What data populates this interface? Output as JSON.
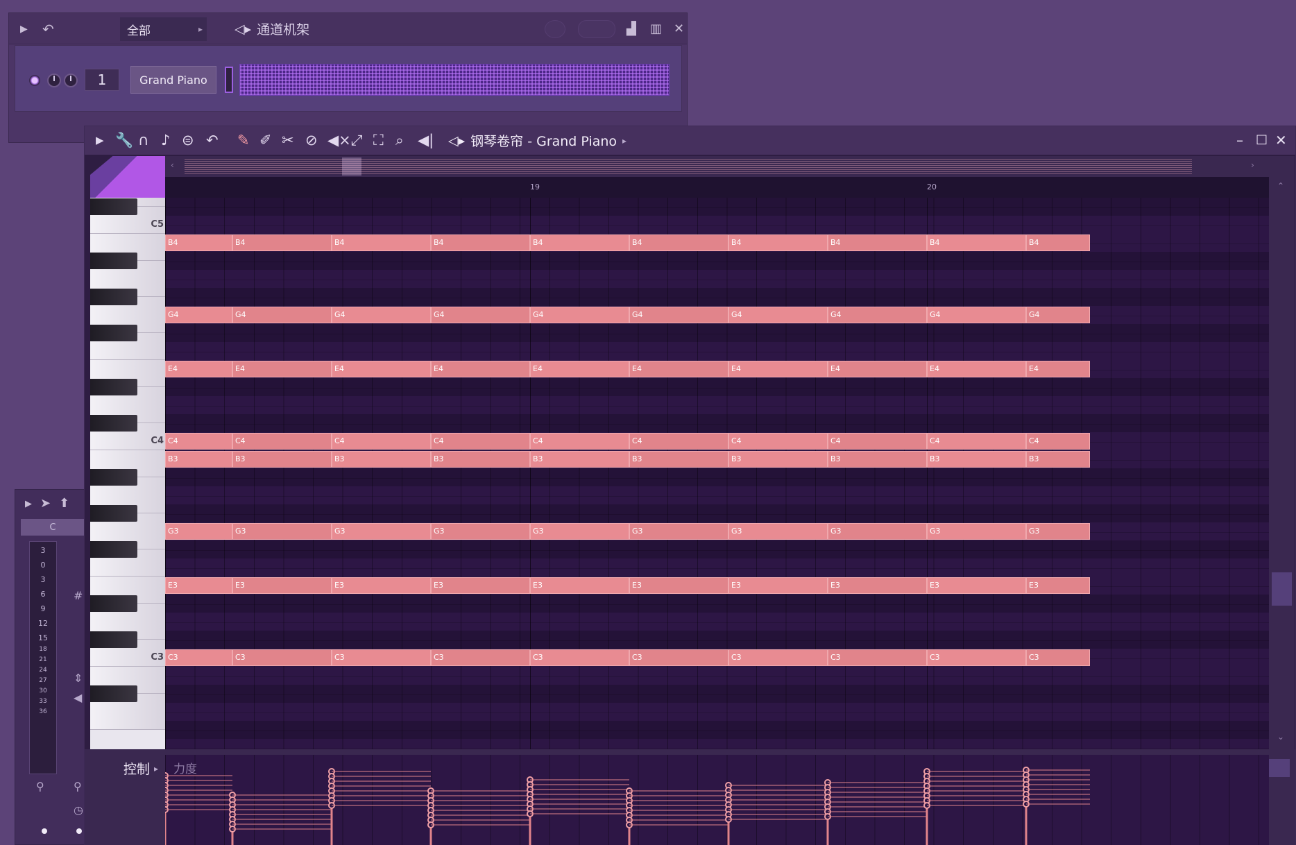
{
  "channel_rack": {
    "filter_label": "全部",
    "title": "通道机架",
    "channel_number": "1",
    "channel_name": "Grand Piano",
    "icons": [
      "play-arrow-icon",
      "undo-icon",
      "speaker-icon",
      "graph-icon",
      "columns-icon",
      "close-icon"
    ]
  },
  "piano_roll": {
    "title": "钢琴卷帘 - Grand Piano",
    "bar_markers": [
      "19",
      "20"
    ],
    "key_labels": [
      "C5",
      "C4",
      "C3"
    ],
    "note_rows": [
      {
        "pitch": "B4"
      },
      {
        "pitch": "G4"
      },
      {
        "pitch": "E4"
      },
      {
        "pitch": "C4"
      },
      {
        "pitch": "B3"
      },
      {
        "pitch": "G3"
      },
      {
        "pitch": "E3"
      },
      {
        "pitch": "C3"
      }
    ],
    "notes_per_row": 10,
    "control_label": "控制",
    "control_param": "力度",
    "tools": [
      "play-arrow-icon",
      "wrench-icon",
      "magnet-icon",
      "note-icon",
      "menu-icon",
      "undo-icon",
      "pencil-icon",
      "paint-brush-icon",
      "delete-icon",
      "mute-icon",
      "mute-off-icon",
      "slice-icon",
      "select-icon",
      "zoom-icon",
      "speaker-icon"
    ],
    "note_color": "#e1848b"
  },
  "mini_panel": {
    "key_value": "C",
    "values": [
      "3",
      "0",
      "3",
      "6",
      "9",
      "12",
      "15",
      "18",
      "21",
      "24",
      "27",
      "30",
      "33",
      "36"
    ]
  }
}
